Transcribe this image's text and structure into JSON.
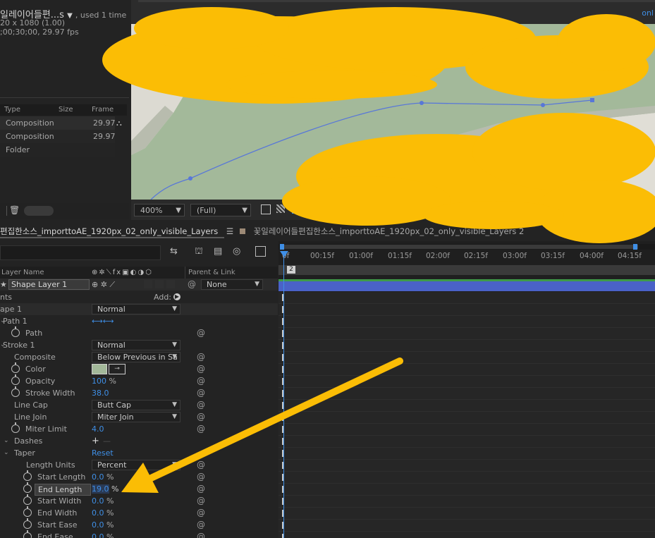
{
  "project": {
    "comp_name": "일레이어들편...s",
    "used_text": ", used 1 time",
    "resolution": "20 x 1080 (1.00)",
    "duration": ";00;30;00, 29.97 fps",
    "columns": [
      "Type",
      "Size",
      "Frame R..."
    ],
    "rows": [
      {
        "type": "Composition",
        "rate": "29.97"
      },
      {
        "type": "Composition",
        "rate": "29.97"
      },
      {
        "type": "Folder",
        "rate": ""
      }
    ]
  },
  "viewer": {
    "top_right_label": "onl",
    "zoom": "400%",
    "quality": "(Full)"
  },
  "timeline": {
    "tab1": "편집한소스_importtoAE_1920px_02_only_visible_Layers",
    "tab2": "꽃일레이어들편집한소스_importtoAE_1920px_02_only_visible_Layers 2",
    "ruler": [
      "0f",
      "00:15f",
      "01:00f",
      "01:15f",
      "02:00f",
      "02:15f",
      "03:00f",
      "03:15f",
      "04:00f",
      "04:15f"
    ],
    "ruler_marker": "2",
    "headers": {
      "layer_name": "Layer Name",
      "parent": "Parent & Link"
    },
    "layer": {
      "name": "Shape Layer 1",
      "parent": "None"
    },
    "properties": [
      {
        "label": "nts",
        "value": "",
        "extra": "Add:"
      },
      {
        "label": "ape 1",
        "value": "Normal"
      },
      {
        "label": "Path 1",
        "value": ""
      },
      {
        "label": "Path",
        "value": ""
      },
      {
        "label": "Stroke 1",
        "value": "Normal"
      },
      {
        "label": "Composite",
        "value": "Below Previous in Sa"
      },
      {
        "label": "Color",
        "value": ""
      },
      {
        "label": "Opacity",
        "value": "100",
        "unit": "%"
      },
      {
        "label": "Stroke Width",
        "value": "38.0"
      },
      {
        "label": "Line Cap",
        "value": "Butt Cap"
      },
      {
        "label": "Line Join",
        "value": "Miter Join"
      },
      {
        "label": "Miter Limit",
        "value": "4.0"
      },
      {
        "label": "Dashes",
        "value": ""
      },
      {
        "label": "Taper",
        "value": "Reset"
      },
      {
        "label": "Length Units",
        "value": "Percent"
      },
      {
        "label": "Start Length",
        "value": "0.0",
        "unit": "%"
      },
      {
        "label": "End Length",
        "value": "19.0",
        "unit": "%"
      },
      {
        "label": "Start Width",
        "value": "0.0",
        "unit": "%"
      },
      {
        "label": "End Width",
        "value": "0.0",
        "unit": "%"
      },
      {
        "label": "Start Ease",
        "value": "0.0",
        "unit": "%"
      },
      {
        "label": "End Ease",
        "value": "0.0",
        "unit": "%"
      }
    ]
  },
  "colors": {
    "accent_blue": "#3f8fe6",
    "annotation": "#fbbd05",
    "stroke_swatch": "#a3b99a"
  }
}
